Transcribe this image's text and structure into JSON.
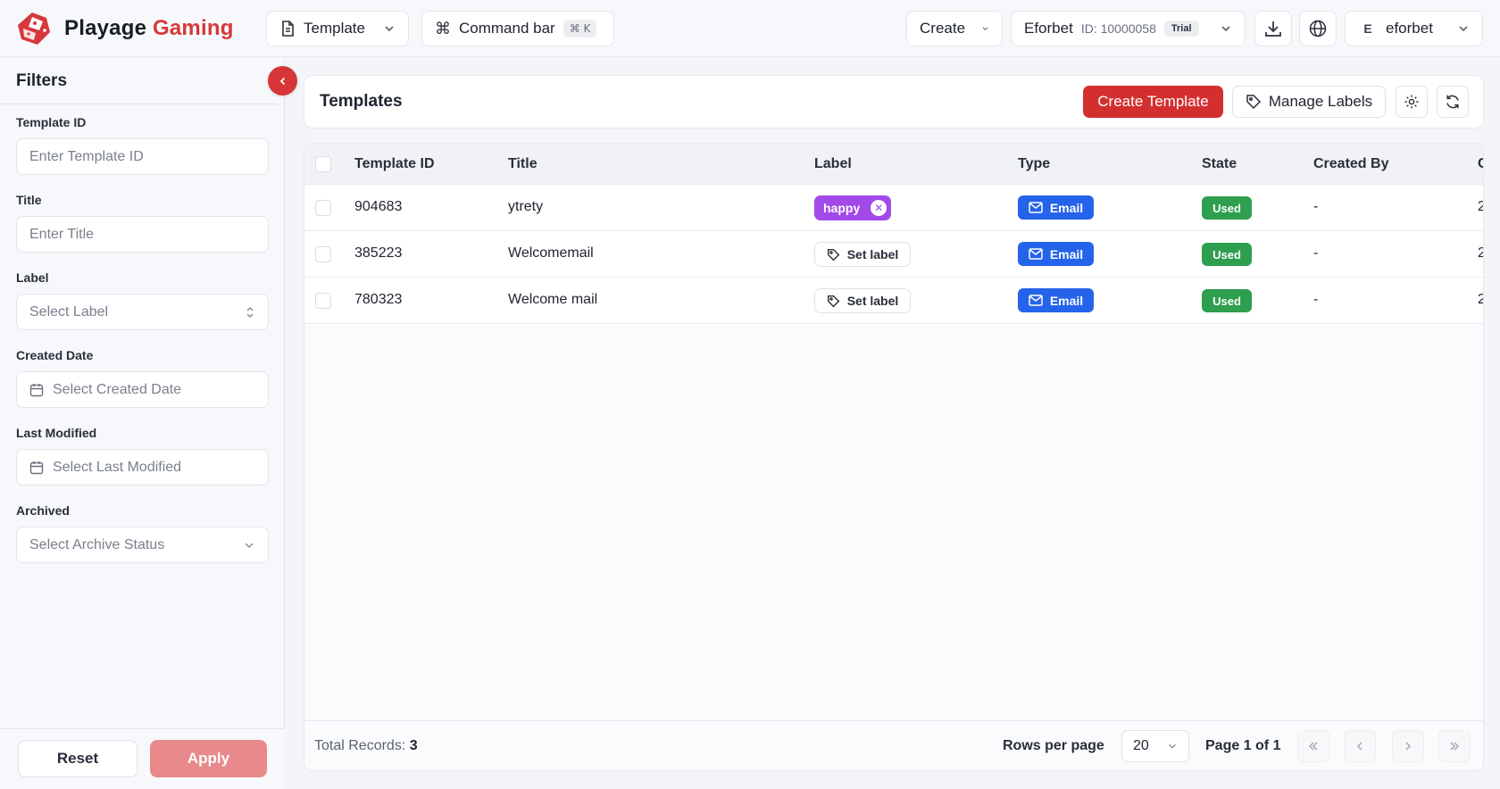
{
  "brand": {
    "name_main": "Playage",
    "name_accent": "Gaming",
    "accent_color": "#d7383b"
  },
  "topbar": {
    "template_menu": {
      "label": "Template",
      "icon": "document-icon"
    },
    "command_bar": {
      "label": "Command bar",
      "shortcut": "⌘ K",
      "icon": "command-icon"
    },
    "create_menu": {
      "label": "Create"
    },
    "account": {
      "name": "Eforbet",
      "id_text": "ID: 10000058",
      "plan": "Trial"
    },
    "download_icon": "download-icon",
    "language_icon": "globe-icon",
    "user": {
      "initial": "E",
      "name": "eforbet"
    }
  },
  "sidebar": {
    "title": "Filters",
    "fields": {
      "template_id": {
        "label": "Template ID",
        "placeholder": "Enter Template ID"
      },
      "title": {
        "label": "Title",
        "placeholder": "Enter Title"
      },
      "label": {
        "label": "Label",
        "placeholder": "Select Label"
      },
      "created_date": {
        "label": "Created Date",
        "placeholder": "Select Created Date"
      },
      "last_modified": {
        "label": "Last Modified",
        "placeholder": "Select Last Modified"
      },
      "archived": {
        "label": "Archived",
        "placeholder": "Select Archive Status"
      }
    },
    "reset_label": "Reset",
    "apply_label": "Apply"
  },
  "main": {
    "title": "Templates",
    "create_label": "Create Template",
    "manage_labels_label": "Manage Labels",
    "table": {
      "columns": [
        "Template ID",
        "Title",
        "Label",
        "Type",
        "State",
        "Created By",
        "C"
      ],
      "rows": [
        {
          "id": "904683",
          "title": "ytrety",
          "label": "happy",
          "type": "Email",
          "state": "Used",
          "created_by": "-",
          "extra": "2"
        },
        {
          "id": "385223",
          "title": "Welcomemail",
          "label": "Set label",
          "type": "Email",
          "state": "Used",
          "created_by": "-",
          "extra": "2"
        },
        {
          "id": "780323",
          "title": "Welcome mail",
          "label": "Set label",
          "type": "Email",
          "state": "Used",
          "created_by": "-",
          "extra": "2"
        }
      ]
    },
    "footer": {
      "total_label": "Total Records:",
      "total_value": "3",
      "rows_per_page_label": "Rows per page",
      "rows_per_page_value": "20",
      "page_info": "Page 1 of 1"
    }
  },
  "colors": {
    "primary_red": "#d32f2f",
    "label_purple": "#a249e8",
    "email_blue": "#2563eb",
    "used_green": "#2e9e4f"
  }
}
